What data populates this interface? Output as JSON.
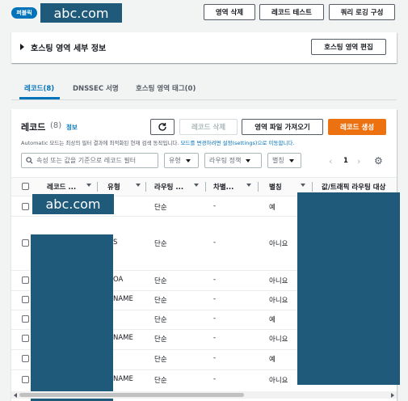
{
  "header": {
    "badge": "퍼블릭",
    "domain_label": "abc.com",
    "buttons": {
      "delete_zone": "영역 삭제",
      "test_record": "레코드 테스트",
      "query_logging": "쿼리 로깅 구성"
    }
  },
  "details_panel": {
    "title": "호스팅 영역 세부 정보",
    "edit_button": "호스팅 영역 편집"
  },
  "tabs": [
    {
      "label": "레코드(8)",
      "active": true
    },
    {
      "label": "DNSSEC 서명",
      "active": false
    },
    {
      "label": "호스팅 영역 태그(0)",
      "active": false
    }
  ],
  "records": {
    "title": "레코드",
    "count": "(8)",
    "info_link": "정보",
    "buttons": {
      "delete": "레코드 삭제",
      "import": "영역 파일 가져오기",
      "create": "레코드 생성"
    },
    "note_prefix": "Automatic 모드는 최상의 필터 결과에 최적화된 현재 검색 동작입니다. ",
    "note_link": "모드를 변경하려면 설정(settings)으로 이동합니다.",
    "search_placeholder": "속성 또는 값을 기준으로 레코드 필터",
    "filters": {
      "type": "유형",
      "routing": "라우팅 정책",
      "alias": "별칭"
    },
    "page_number": "1",
    "columns": [
      "레코드 ...",
      "유형",
      "라우팅 ...",
      "차별...",
      "별칭",
      "값/트래픽 라우팅 대상"
    ],
    "domain_overlay": "abc.com",
    "rows": [
      {
        "type": "",
        "routing": "단순",
        "diff": "-",
        "alias": "예"
      },
      {
        "type": "S",
        "routing": "단순",
        "diff": "-",
        "alias": "아니요"
      },
      {
        "type": "OA",
        "routing": "단순",
        "diff": "-",
        "alias": "아니요"
      },
      {
        "type": "NAME",
        "routing": "단순",
        "diff": "-",
        "alias": "아니요"
      },
      {
        "type": "",
        "routing": "단순",
        "diff": "-",
        "alias": "예"
      },
      {
        "type": "NAME",
        "routing": "단순",
        "diff": "-",
        "alias": "아니요"
      },
      {
        "type": "",
        "routing": "단순",
        "diff": "-",
        "alias": "예"
      },
      {
        "type": "NAME",
        "routing": "단순",
        "diff": "-",
        "alias": "아니요"
      }
    ]
  },
  "colors": {
    "accent": "#0073bb",
    "primary": "#ec7211",
    "redaction": "#1f5a7a"
  }
}
